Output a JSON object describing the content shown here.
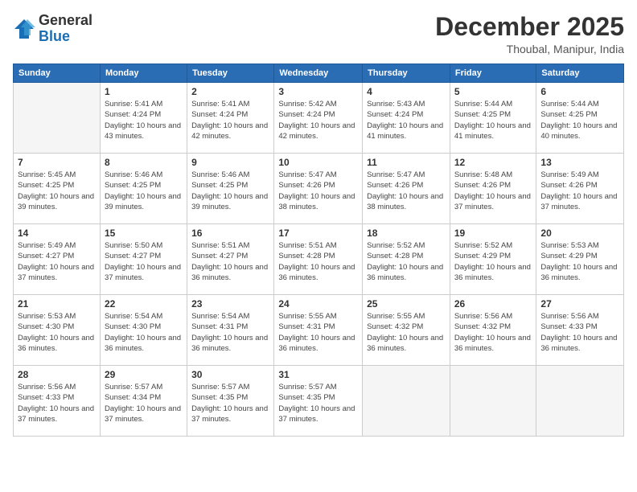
{
  "logo": {
    "general": "General",
    "blue": "Blue"
  },
  "header": {
    "month": "December 2025",
    "location": "Thoubal, Manipur, India"
  },
  "weekdays": [
    "Sunday",
    "Monday",
    "Tuesday",
    "Wednesday",
    "Thursday",
    "Friday",
    "Saturday"
  ],
  "weeks": [
    [
      {
        "day": "",
        "sunrise": "",
        "sunset": "",
        "daylight": ""
      },
      {
        "day": "1",
        "sunrise": "Sunrise: 5:41 AM",
        "sunset": "Sunset: 4:24 PM",
        "daylight": "Daylight: 10 hours and 43 minutes."
      },
      {
        "day": "2",
        "sunrise": "Sunrise: 5:41 AM",
        "sunset": "Sunset: 4:24 PM",
        "daylight": "Daylight: 10 hours and 42 minutes."
      },
      {
        "day": "3",
        "sunrise": "Sunrise: 5:42 AM",
        "sunset": "Sunset: 4:24 PM",
        "daylight": "Daylight: 10 hours and 42 minutes."
      },
      {
        "day": "4",
        "sunrise": "Sunrise: 5:43 AM",
        "sunset": "Sunset: 4:24 PM",
        "daylight": "Daylight: 10 hours and 41 minutes."
      },
      {
        "day": "5",
        "sunrise": "Sunrise: 5:44 AM",
        "sunset": "Sunset: 4:25 PM",
        "daylight": "Daylight: 10 hours and 41 minutes."
      },
      {
        "day": "6",
        "sunrise": "Sunrise: 5:44 AM",
        "sunset": "Sunset: 4:25 PM",
        "daylight": "Daylight: 10 hours and 40 minutes."
      }
    ],
    [
      {
        "day": "7",
        "sunrise": "Sunrise: 5:45 AM",
        "sunset": "Sunset: 4:25 PM",
        "daylight": "Daylight: 10 hours and 39 minutes."
      },
      {
        "day": "8",
        "sunrise": "Sunrise: 5:46 AM",
        "sunset": "Sunset: 4:25 PM",
        "daylight": "Daylight: 10 hours and 39 minutes."
      },
      {
        "day": "9",
        "sunrise": "Sunrise: 5:46 AM",
        "sunset": "Sunset: 4:25 PM",
        "daylight": "Daylight: 10 hours and 39 minutes."
      },
      {
        "day": "10",
        "sunrise": "Sunrise: 5:47 AM",
        "sunset": "Sunset: 4:26 PM",
        "daylight": "Daylight: 10 hours and 38 minutes."
      },
      {
        "day": "11",
        "sunrise": "Sunrise: 5:47 AM",
        "sunset": "Sunset: 4:26 PM",
        "daylight": "Daylight: 10 hours and 38 minutes."
      },
      {
        "day": "12",
        "sunrise": "Sunrise: 5:48 AM",
        "sunset": "Sunset: 4:26 PM",
        "daylight": "Daylight: 10 hours and 37 minutes."
      },
      {
        "day": "13",
        "sunrise": "Sunrise: 5:49 AM",
        "sunset": "Sunset: 4:26 PM",
        "daylight": "Daylight: 10 hours and 37 minutes."
      }
    ],
    [
      {
        "day": "14",
        "sunrise": "Sunrise: 5:49 AM",
        "sunset": "Sunset: 4:27 PM",
        "daylight": "Daylight: 10 hours and 37 minutes."
      },
      {
        "day": "15",
        "sunrise": "Sunrise: 5:50 AM",
        "sunset": "Sunset: 4:27 PM",
        "daylight": "Daylight: 10 hours and 37 minutes."
      },
      {
        "day": "16",
        "sunrise": "Sunrise: 5:51 AM",
        "sunset": "Sunset: 4:27 PM",
        "daylight": "Daylight: 10 hours and 36 minutes."
      },
      {
        "day": "17",
        "sunrise": "Sunrise: 5:51 AM",
        "sunset": "Sunset: 4:28 PM",
        "daylight": "Daylight: 10 hours and 36 minutes."
      },
      {
        "day": "18",
        "sunrise": "Sunrise: 5:52 AM",
        "sunset": "Sunset: 4:28 PM",
        "daylight": "Daylight: 10 hours and 36 minutes."
      },
      {
        "day": "19",
        "sunrise": "Sunrise: 5:52 AM",
        "sunset": "Sunset: 4:29 PM",
        "daylight": "Daylight: 10 hours and 36 minutes."
      },
      {
        "day": "20",
        "sunrise": "Sunrise: 5:53 AM",
        "sunset": "Sunset: 4:29 PM",
        "daylight": "Daylight: 10 hours and 36 minutes."
      }
    ],
    [
      {
        "day": "21",
        "sunrise": "Sunrise: 5:53 AM",
        "sunset": "Sunset: 4:30 PM",
        "daylight": "Daylight: 10 hours and 36 minutes."
      },
      {
        "day": "22",
        "sunrise": "Sunrise: 5:54 AM",
        "sunset": "Sunset: 4:30 PM",
        "daylight": "Daylight: 10 hours and 36 minutes."
      },
      {
        "day": "23",
        "sunrise": "Sunrise: 5:54 AM",
        "sunset": "Sunset: 4:31 PM",
        "daylight": "Daylight: 10 hours and 36 minutes."
      },
      {
        "day": "24",
        "sunrise": "Sunrise: 5:55 AM",
        "sunset": "Sunset: 4:31 PM",
        "daylight": "Daylight: 10 hours and 36 minutes."
      },
      {
        "day": "25",
        "sunrise": "Sunrise: 5:55 AM",
        "sunset": "Sunset: 4:32 PM",
        "daylight": "Daylight: 10 hours and 36 minutes."
      },
      {
        "day": "26",
        "sunrise": "Sunrise: 5:56 AM",
        "sunset": "Sunset: 4:32 PM",
        "daylight": "Daylight: 10 hours and 36 minutes."
      },
      {
        "day": "27",
        "sunrise": "Sunrise: 5:56 AM",
        "sunset": "Sunset: 4:33 PM",
        "daylight": "Daylight: 10 hours and 36 minutes."
      }
    ],
    [
      {
        "day": "28",
        "sunrise": "Sunrise: 5:56 AM",
        "sunset": "Sunset: 4:33 PM",
        "daylight": "Daylight: 10 hours and 37 minutes."
      },
      {
        "day": "29",
        "sunrise": "Sunrise: 5:57 AM",
        "sunset": "Sunset: 4:34 PM",
        "daylight": "Daylight: 10 hours and 37 minutes."
      },
      {
        "day": "30",
        "sunrise": "Sunrise: 5:57 AM",
        "sunset": "Sunset: 4:35 PM",
        "daylight": "Daylight: 10 hours and 37 minutes."
      },
      {
        "day": "31",
        "sunrise": "Sunrise: 5:57 AM",
        "sunset": "Sunset: 4:35 PM",
        "daylight": "Daylight: 10 hours and 37 minutes."
      },
      {
        "day": "",
        "sunrise": "",
        "sunset": "",
        "daylight": ""
      },
      {
        "day": "",
        "sunrise": "",
        "sunset": "",
        "daylight": ""
      },
      {
        "day": "",
        "sunrise": "",
        "sunset": "",
        "daylight": ""
      }
    ]
  ]
}
